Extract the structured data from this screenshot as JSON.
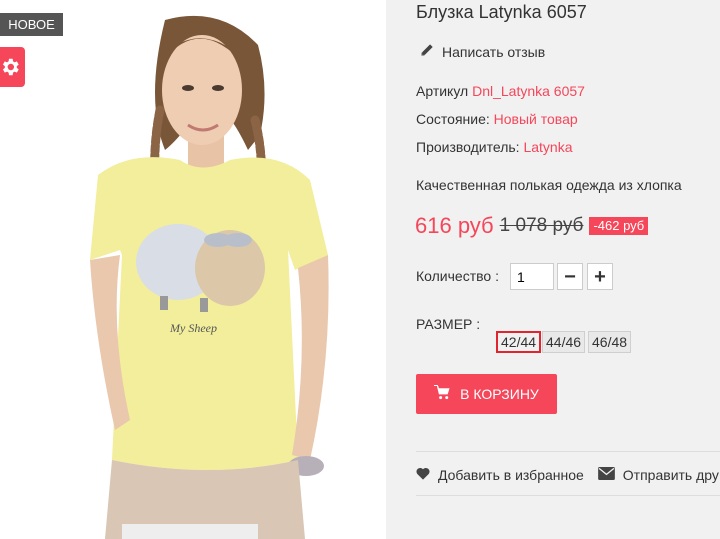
{
  "image": {
    "badge": "НОВОЕ",
    "tshirt_print": "My Sheep"
  },
  "product": {
    "title": "Блузка Latynka 6057",
    "review_link": "Написать отзыв",
    "article_label": "Артикул",
    "article_value": "Dnl_Latynka 6057",
    "condition_label": "Состояние:",
    "condition_value": "Новый товар",
    "manufacturer_label": "Производитель:",
    "manufacturer_value": "Latynka",
    "description": "Качественная полькая одежда из хлопка",
    "price_new": "616 руб",
    "price_old": "1 078 руб",
    "discount": "-462 руб",
    "quantity_label": "Количество :",
    "quantity_value": "1",
    "qty_minus": "−",
    "qty_plus": "+",
    "size_label": "РАЗМЕР :",
    "sizes": [
      "42/44",
      "44/46",
      "46/48"
    ],
    "selected_size": "42/44",
    "cart_button": "В КОРЗИНУ",
    "wishlist_link": "Добавить в избранное",
    "send_friend_link": "Отправить дру"
  },
  "colors": {
    "accent": "#f5465a",
    "panel_bg": "#f1f1f1",
    "selected_size_border": "#e2242f"
  },
  "icons": [
    "gear-icon",
    "pencil-icon",
    "cart-icon",
    "heart-icon",
    "envelope-icon"
  ]
}
